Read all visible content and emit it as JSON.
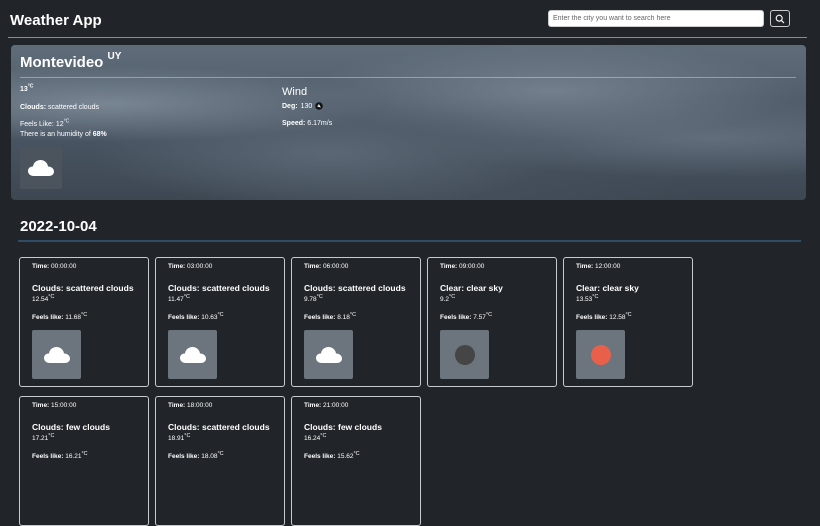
{
  "app": {
    "title": "Weather App",
    "search": {
      "placeholder": "Enter the city you want to search here",
      "button_icon": "search-icon"
    }
  },
  "current": {
    "city": "Montevideo",
    "country": "UY",
    "temp": "13",
    "temp_unit": "°C",
    "clouds_label": "Clouds:",
    "clouds": "scattered clouds",
    "feels_like_label": "Feels Like:",
    "feels_like": "12",
    "feels_unit": "°C",
    "humidity_prefix": "There is an humidity of",
    "humidity": "68%",
    "icon": "cloud-icon",
    "wind": {
      "title": "Wind",
      "deg_label": "Deg:",
      "deg": "130",
      "speed_label": "Speed:",
      "speed": "6.17m/s"
    }
  },
  "forecast": {
    "date": "2022-10-04",
    "time_label": "Time:",
    "feels_label": "Feels like:",
    "unit": "°C",
    "items": [
      {
        "time": "00:00:00",
        "desc": "Clouds: scattered clouds",
        "temp": "12.54",
        "feels": "11.68",
        "icon": "cloud-icon"
      },
      {
        "time": "03:00:00",
        "desc": "Clouds: scattered clouds",
        "temp": "11.47",
        "feels": "10.63",
        "icon": "cloud-icon"
      },
      {
        "time": "06:00:00",
        "desc": "Clouds: scattered clouds",
        "temp": "9.78",
        "feels": "8.18",
        "icon": "cloud-icon"
      },
      {
        "time": "09:00:00",
        "desc": "Clear: clear sky",
        "temp": "9.2",
        "feels": "7.57",
        "icon": "moon-icon",
        "icon_color": "#454545"
      },
      {
        "time": "12:00:00",
        "desc": "Clear: clear sky",
        "temp": "13.53",
        "feels": "12.58",
        "icon": "sun-icon",
        "icon_color": "#e8604a"
      },
      {
        "time": "15:00:00",
        "desc": "Clouds: few clouds",
        "temp": "17.21",
        "feels": "16.21"
      },
      {
        "time": "18:00:00",
        "desc": "Clouds: scattered clouds",
        "temp": "18.91",
        "feels": "18.08"
      },
      {
        "time": "21:00:00",
        "desc": "Clouds: few clouds",
        "temp": "16.24",
        "feels": "15.62"
      }
    ]
  }
}
